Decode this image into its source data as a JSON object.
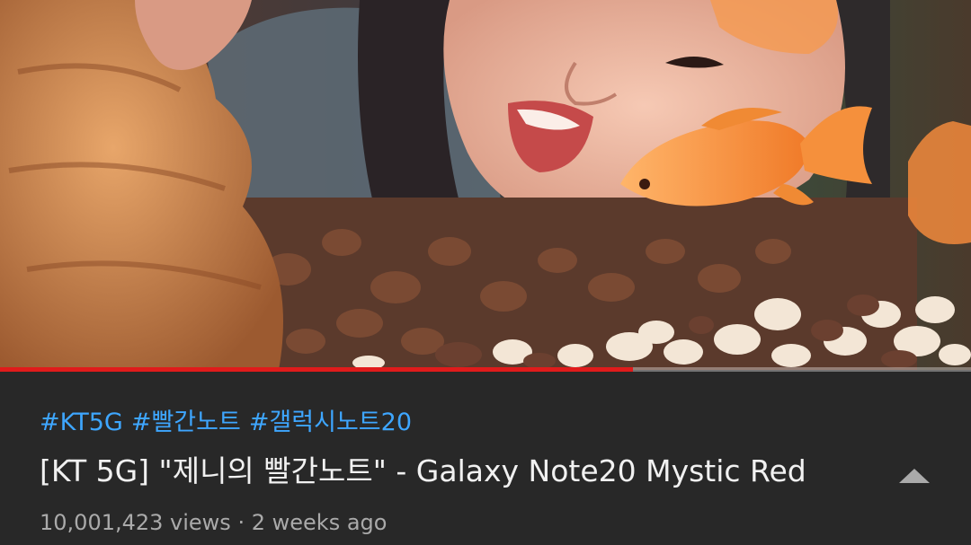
{
  "video": {
    "progress_fraction": 0.652
  },
  "info": {
    "hashtags": [
      "#KT5G",
      "#빨간노트",
      "#갤럭시노트20"
    ],
    "title": "[KT 5G] \"제니의 빨간노트\" - Galaxy Note20 Mystic Red",
    "views": "10,001,423 views",
    "separator": "·",
    "age": "2 weeks ago",
    "collapse_icon": "triangle-up-icon"
  },
  "colors": {
    "background": "#282828",
    "hashtag": "#3ea6ff",
    "title": "#f1f1f1",
    "meta": "#aaaaaa",
    "progress": "#e01b1b"
  }
}
